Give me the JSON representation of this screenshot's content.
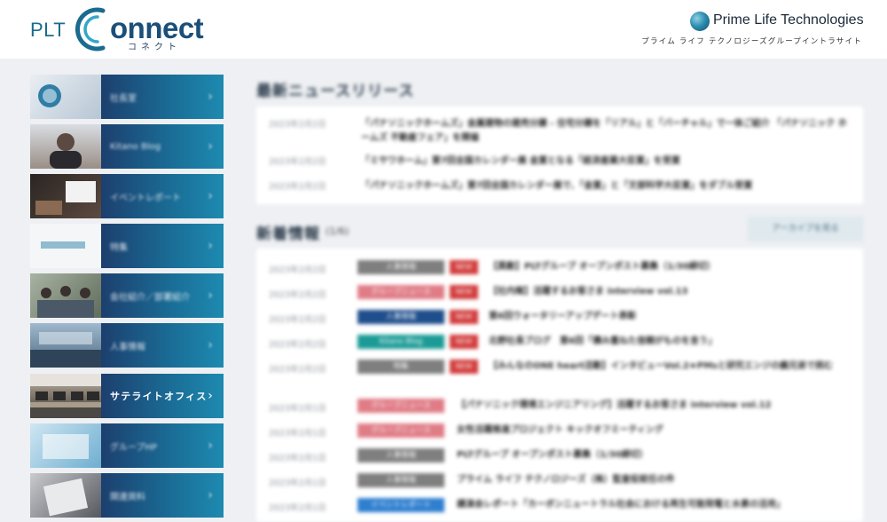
{
  "header": {
    "logo_prefix": "PLT",
    "logo_main": "onnect",
    "logo_kana": "コネクト",
    "brand_name": "Prime Life Technologies",
    "brand_sub": "プライム ライフ テクノロジーズグループイントラサイト"
  },
  "sidebar": {
    "items": [
      {
        "label": "社長室",
        "thumb": "#cfd9e3"
      },
      {
        "label": "Kitano Blog",
        "thumb": "#8a7f78"
      },
      {
        "label": "イベントレポート",
        "thumb": "#3d3330"
      },
      {
        "label": "特集",
        "thumb": "#e8ecef"
      },
      {
        "label": "会社紹介／部署紹介",
        "thumb": "#8b9a86"
      },
      {
        "label": "人事情報",
        "thumb": "#6f8fa6"
      },
      {
        "label": "サテライトオフィス",
        "thumb": "#5a5248"
      },
      {
        "label": "グループHP",
        "thumb": "#9fc6dc"
      },
      {
        "label": "関連資料",
        "thumb": "#7a7d82"
      }
    ]
  },
  "news": {
    "title": "最新ニュースリリース",
    "rows": [
      {
        "date": "2023年2月2日",
        "text": "「パナソニックホームズ」金属建物の建売分譲 - 住宅分譲を「リアル」と「バーチャル」で一体ご紹介 「パナソニック ホームズ 不動産フェア」を開催"
      },
      {
        "date": "2023年2月2日",
        "text": "「ミサワホーム」第7回全国カレンダー展 金賞となる「経済産業大臣賞」を受賞"
      },
      {
        "date": "2023年2月2日",
        "text": "「パナソニックホームズ」第7回全国カレンダー展で、「金賞」と「文部科学大臣賞」をダブル受賞"
      }
    ]
  },
  "new_info": {
    "title": "新着情報",
    "count": "(1/6)",
    "archive_label": "アーカイブを見る",
    "new_badge": "NEW",
    "rows": [
      {
        "date": "2023年2月2日",
        "cat": "人事情報",
        "cat_color": "#7f7f7f",
        "new": true,
        "title": "【異動】PLTグループ オープンポスト募集（1/30締切）"
      },
      {
        "date": "2023年2月2日",
        "cat": "グループニュース",
        "cat_color": "#e07c86",
        "new": true,
        "title": "【社内報】活躍するお客さま interview vol.13"
      },
      {
        "date": "2023年2月2日",
        "cat": "人事情報",
        "cat_color": "#1f4e8c",
        "new": true,
        "title": "第6回ウォータリーアップデート表彰"
      },
      {
        "date": "2023年2月2日",
        "cat": "Kitano Blog",
        "cat_color": "#1c9b96",
        "new": true,
        "title": "北野社長ブログ　第6回「積み重ねた信頼がものを言う」"
      },
      {
        "date": "2023年2月2日",
        "cat": "特集",
        "cat_color": "#7f7f7f",
        "new": true,
        "title": "【みんなのONE heart活動】インタビューVol.2★PMsと研究エンジの義兄弟で挑む"
      },
      {
        "date": "2023年2月1日",
        "cat": "グループニュース",
        "cat_color": "#e07c86",
        "new": false,
        "title": "【パナソニック環境エンジニアリング】活躍するお客さま interview vol.12"
      },
      {
        "date": "2023年2月1日",
        "cat": "グループニュース",
        "cat_color": "#e07c86",
        "new": false,
        "title": "女性活躍推進プロジェクト キックオフミーティング"
      },
      {
        "date": "2023年2月1日",
        "cat": "人事情報",
        "cat_color": "#7f7f7f",
        "new": false,
        "title": "PLTグループ オープンポスト募集（1/30締切）"
      },
      {
        "date": "2023年2月1日",
        "cat": "人事情報",
        "cat_color": "#7f7f7f",
        "new": false,
        "title": "プライム ライフ テクノロジーズ（株）監査役就任の件"
      },
      {
        "date": "2023年2月1日",
        "cat": "イベントレポート",
        "cat_color": "#2f7fd0",
        "new": false,
        "title": "講演会レポート「カーボンニュートラル社会における再生可能発電と水素の活用」"
      }
    ]
  }
}
